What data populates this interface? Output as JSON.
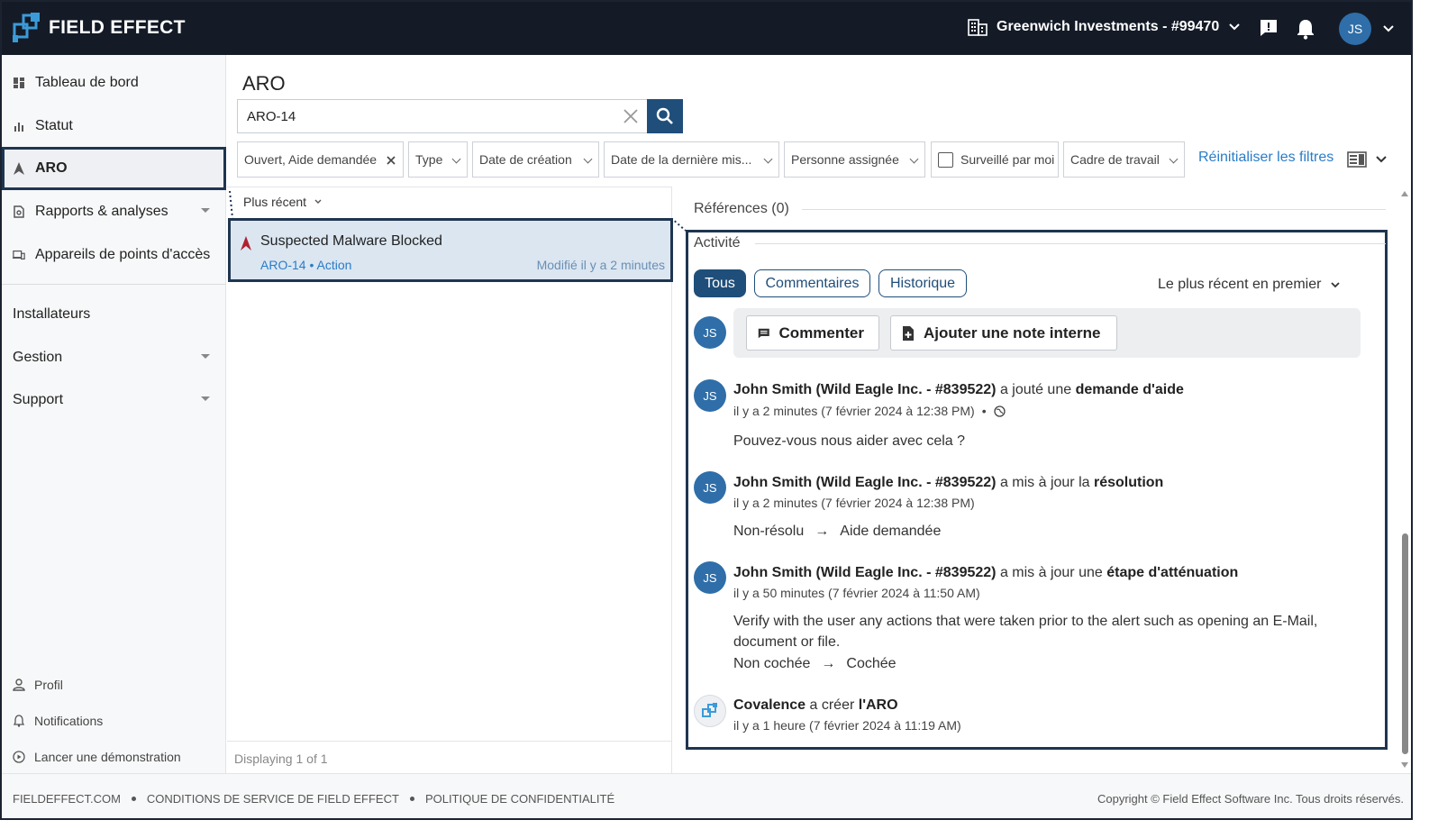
{
  "brand": {
    "name": "FIELD EFFECT"
  },
  "header": {
    "org_name": "Greenwich Investments - #99470",
    "user_initials": "JS"
  },
  "sidebar": {
    "items": [
      {
        "label": "Tableau de bord"
      },
      {
        "label": "Statut"
      },
      {
        "label": "ARO"
      },
      {
        "label": "Rapports & analyses"
      },
      {
        "label": "Appareils de points d'accès"
      }
    ],
    "sections": [
      {
        "label": "Installateurs"
      },
      {
        "label": "Gestion"
      },
      {
        "label": "Support"
      }
    ],
    "bottom": [
      {
        "label": "Profil"
      },
      {
        "label": "Notifications"
      },
      {
        "label": "Lancer une démonstration"
      }
    ]
  },
  "main": {
    "title": "ARO",
    "search": {
      "value": "ARO-14"
    },
    "filters": {
      "status": "Ouvert, Aide demandée",
      "type": "Type",
      "created": "Date de création",
      "updated": "Date de la dernière mis...",
      "assignee": "Personne assignée",
      "watched": "Surveillé par moi",
      "framework": "Cadre de travail",
      "reset": "Réinitialiser les filtres"
    },
    "list": {
      "sort_label": "Plus récent",
      "items": [
        {
          "title": "Suspected Malware Blocked",
          "meta": "ARO-14 • Action",
          "modified": "Modifié il y a 2 minutes"
        }
      ],
      "footer": "Displaying 1 of 1"
    }
  },
  "detail": {
    "references": "Références (0)",
    "activity_title": "Activité",
    "tabs": {
      "all": "Tous",
      "comments": "Commentaires",
      "history": "Historique"
    },
    "order": "Le plus récent en premier",
    "composer": {
      "comment": "Commenter",
      "internal_note": "Ajouter une note interne",
      "initials": "JS"
    },
    "entries": [
      {
        "initials": "JS",
        "author": "John Smith (Wild Eagle Inc. - #839522)",
        "action": "a jouté une",
        "target": "demande d'aide",
        "time": "il y a 2 minutes (7 février 2024 à 12:38 PM)",
        "separator": "•",
        "body": "Pouvez-vous nous aider avec cela ?"
      },
      {
        "initials": "JS",
        "author": "John Smith (Wild Eagle Inc. - #839522)",
        "action": "a mis à jour la",
        "target": "résolution",
        "time": "il y a 2 minutes (7 février 2024 à 12:38 PM)",
        "from": "Non-résolu",
        "arrow": "→",
        "to": "Aide demandée"
      },
      {
        "initials": "JS",
        "author": "John Smith (Wild Eagle Inc. - #839522)",
        "action": "a mis à jour une",
        "target": "étape d'atténuation",
        "time": "il y a 50 minutes (7 février 2024 à 11:50 AM)",
        "body": "Verify with the user any actions that were taken prior to the alert such as opening an E-Mail, document or file.",
        "from": "Non cochée",
        "arrow": "→",
        "to": "Cochée"
      },
      {
        "author": "Covalence",
        "action": "a créer",
        "target": "l'ARO",
        "time": "il y a 1 heure (7 février 2024 à 11:19 AM)"
      }
    ]
  },
  "footer": {
    "link1": "FIELDEFFECT.COM",
    "link2": "CONDITIONS DE SERVICE DE FIELD EFFECT",
    "link3": "POLITIQUE DE CONFIDENTIALITÉ",
    "copyright": "Copyright © Field Effect Software Inc. Tous droits réservés."
  },
  "colors": {
    "topbar": "#141b27",
    "accent": "#1f4e7a",
    "link": "#2a7cc7",
    "selected": "#dbe6f1",
    "alert": "#b0202e"
  }
}
